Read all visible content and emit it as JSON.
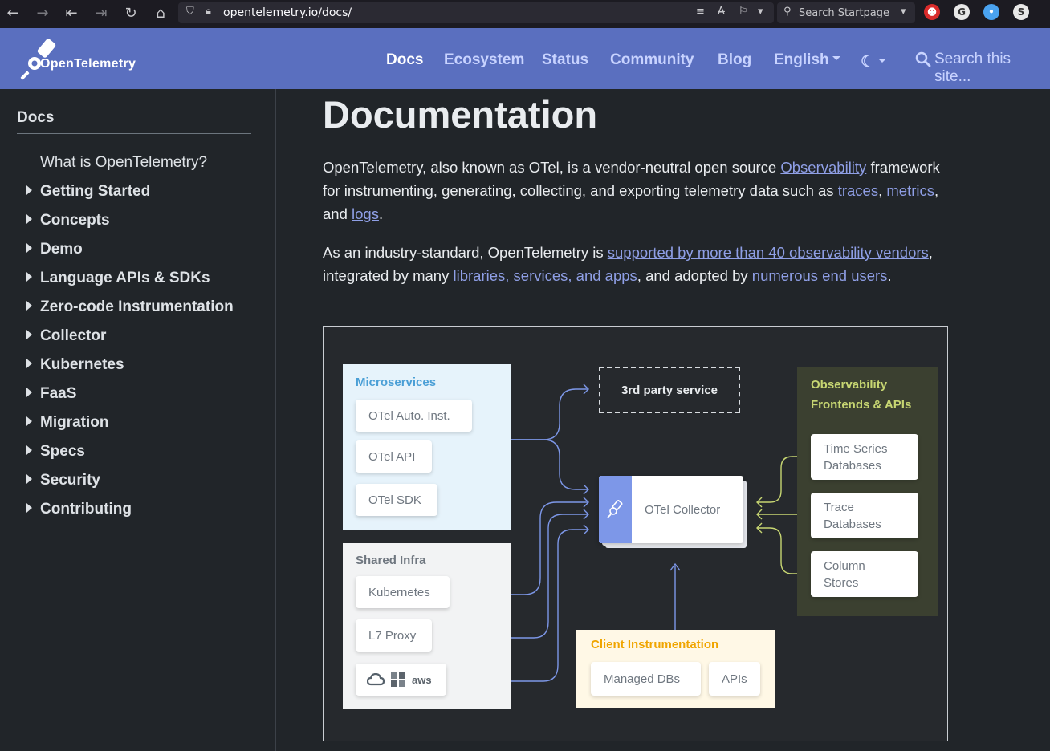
{
  "browser": {
    "url": "opentelemetry.io/docs/",
    "search_placeholder": "Search Startpage"
  },
  "nav": {
    "brand": "OpenTelemetry",
    "links": [
      "Docs",
      "Ecosystem",
      "Status",
      "Community",
      "Blog"
    ],
    "language": "English",
    "search_placeholder": "Search this site..."
  },
  "sidebar": {
    "title": "Docs",
    "items": [
      {
        "label": "What is OpenTelemetry?",
        "expandable": false
      },
      {
        "label": "Getting Started",
        "expandable": true
      },
      {
        "label": "Concepts",
        "expandable": true
      },
      {
        "label": "Demo",
        "expandable": true
      },
      {
        "label": "Language APIs & SDKs",
        "expandable": true
      },
      {
        "label": "Zero-code Instrumentation",
        "expandable": true
      },
      {
        "label": "Collector",
        "expandable": true
      },
      {
        "label": "Kubernetes",
        "expandable": true
      },
      {
        "label": "FaaS",
        "expandable": true
      },
      {
        "label": "Migration",
        "expandable": true
      },
      {
        "label": "Specs",
        "expandable": true
      },
      {
        "label": "Security",
        "expandable": true
      },
      {
        "label": "Contributing",
        "expandable": true
      }
    ]
  },
  "main": {
    "title": "Documentation",
    "p1": {
      "t1": "OpenTelemetry, also known as OTel, is a vendor-neutral open source ",
      "link_observability": "Observability",
      "t2": " framework for instrumenting, generating, collecting, and exporting telemetry data such as ",
      "link_traces": "traces",
      "sep1": ", ",
      "link_metrics": "metrics",
      "sep2": ", and ",
      "link_logs": "logs",
      "end": "."
    },
    "p2": {
      "t1": "As an industry-standard, OpenTelemetry is ",
      "link_vendors": "supported by more than 40 observability vendors",
      "t2": ", integrated by many ",
      "link_libraries": "libraries, services, and apps",
      "t3": ", and adopted by ",
      "link_users": "numerous end users",
      "end": "."
    }
  },
  "diagram": {
    "microservices": {
      "title": "Microservices",
      "items": [
        "OTel Auto. Inst.",
        "OTel API",
        "OTel SDK"
      ]
    },
    "shared_infra": {
      "title": "Shared Infra",
      "items": [
        "Kubernetes",
        "L7 Proxy"
      ],
      "cloud_label": "aws"
    },
    "third_party": "3rd party service",
    "collector": "OTel Collector",
    "client": {
      "title": "Client Instrumentation",
      "items": [
        "Managed DBs",
        "APIs"
      ]
    },
    "frontends": {
      "title_line1": "Observability",
      "title_line2": "Frontends & APIs",
      "items": [
        {
          "l1": "Time Series",
          "l2": "Databases"
        },
        {
          "l1": "Trace",
          "l2": "Databases"
        },
        {
          "l1": "Column",
          "l2": "Stores"
        }
      ]
    },
    "colors": {
      "microservices_bg": "#e6f3fb",
      "microservices_title": "#4a9fd6",
      "infra_bg": "#f2f3f4",
      "infra_title": "#6f7780",
      "client_bg": "#fff8e6",
      "client_title": "#f0a500",
      "frontends_bg": "#3b4030",
      "frontends_title": "#c7d672",
      "wire_blue": "#7d97e8",
      "wire_green": "#c7d672",
      "collector_accent": "#7d97e8"
    }
  }
}
